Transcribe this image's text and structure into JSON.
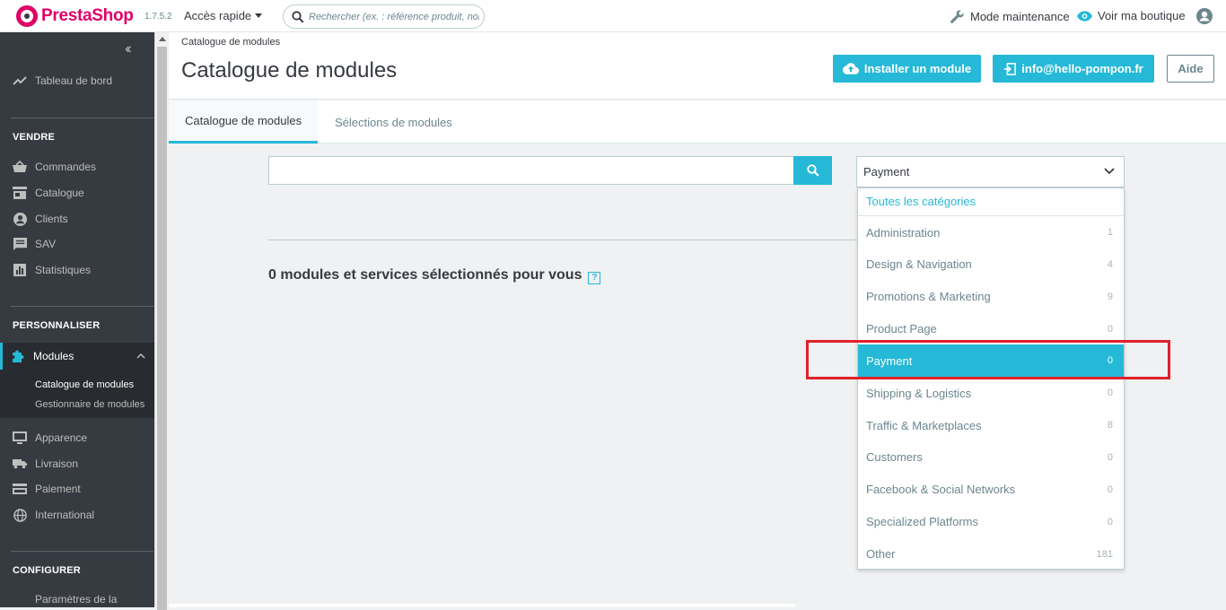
{
  "topbar": {
    "brand": "PrestaShop",
    "version": "1.7.5.2",
    "quick_access": "Accès rapide",
    "search_placeholder": "Rechercher (ex. : référence produit, nom",
    "maintenance": "Mode maintenance",
    "view_shop": "Voir ma boutique"
  },
  "sidebar": {
    "dashboard": "Tableau de bord",
    "section_sell": "VENDRE",
    "orders": "Commandes",
    "catalog": "Catalogue",
    "customers": "Clients",
    "service": "SAV",
    "stats": "Statistiques",
    "section_customize": "PERSONNALISER",
    "modules": "Modules",
    "sub_catalog": "Catalogue de modules",
    "sub_manager": "Gestionnaire de modules",
    "design": "Apparence",
    "shipping": "Livraison",
    "payment": "Paiement",
    "international": "International",
    "section_configure": "CONFIGURER",
    "settings": "Paramètres de la"
  },
  "header": {
    "breadcrumb": "Catalogue de modules",
    "title": "Catalogue de modules",
    "install_button": "Installer un module",
    "account_button": "info@hello-pompon.fr",
    "help_button": "Aide"
  },
  "tabs": {
    "catalog": "Catalogue de modules",
    "selections": "Sélections de modules"
  },
  "content": {
    "result_title": "0 modules et services sélectionnés pour vous",
    "help_mark": "?"
  },
  "category_select": {
    "selected": "Payment",
    "all_label": "Toutes les catégories",
    "items": [
      {
        "label": "Administration",
        "count": "1"
      },
      {
        "label": "Design & Navigation",
        "count": "4"
      },
      {
        "label": "Promotions & Marketing",
        "count": "9"
      },
      {
        "label": "Product Page",
        "count": "0"
      },
      {
        "label": "Payment",
        "count": "0"
      },
      {
        "label": "Shipping & Logistics",
        "count": "0"
      },
      {
        "label": "Traffic & Marketplaces",
        "count": "8"
      },
      {
        "label": "Customers",
        "count": "0"
      },
      {
        "label": "Facebook & Social Networks",
        "count": "0"
      },
      {
        "label": "Specialized Platforms",
        "count": "0"
      },
      {
        "label": "Other",
        "count": "181"
      }
    ]
  },
  "colors": {
    "accent": "#25b9d7",
    "brand": "#df0067",
    "sidebar": "#363a41",
    "annotation": "#e0212b"
  }
}
